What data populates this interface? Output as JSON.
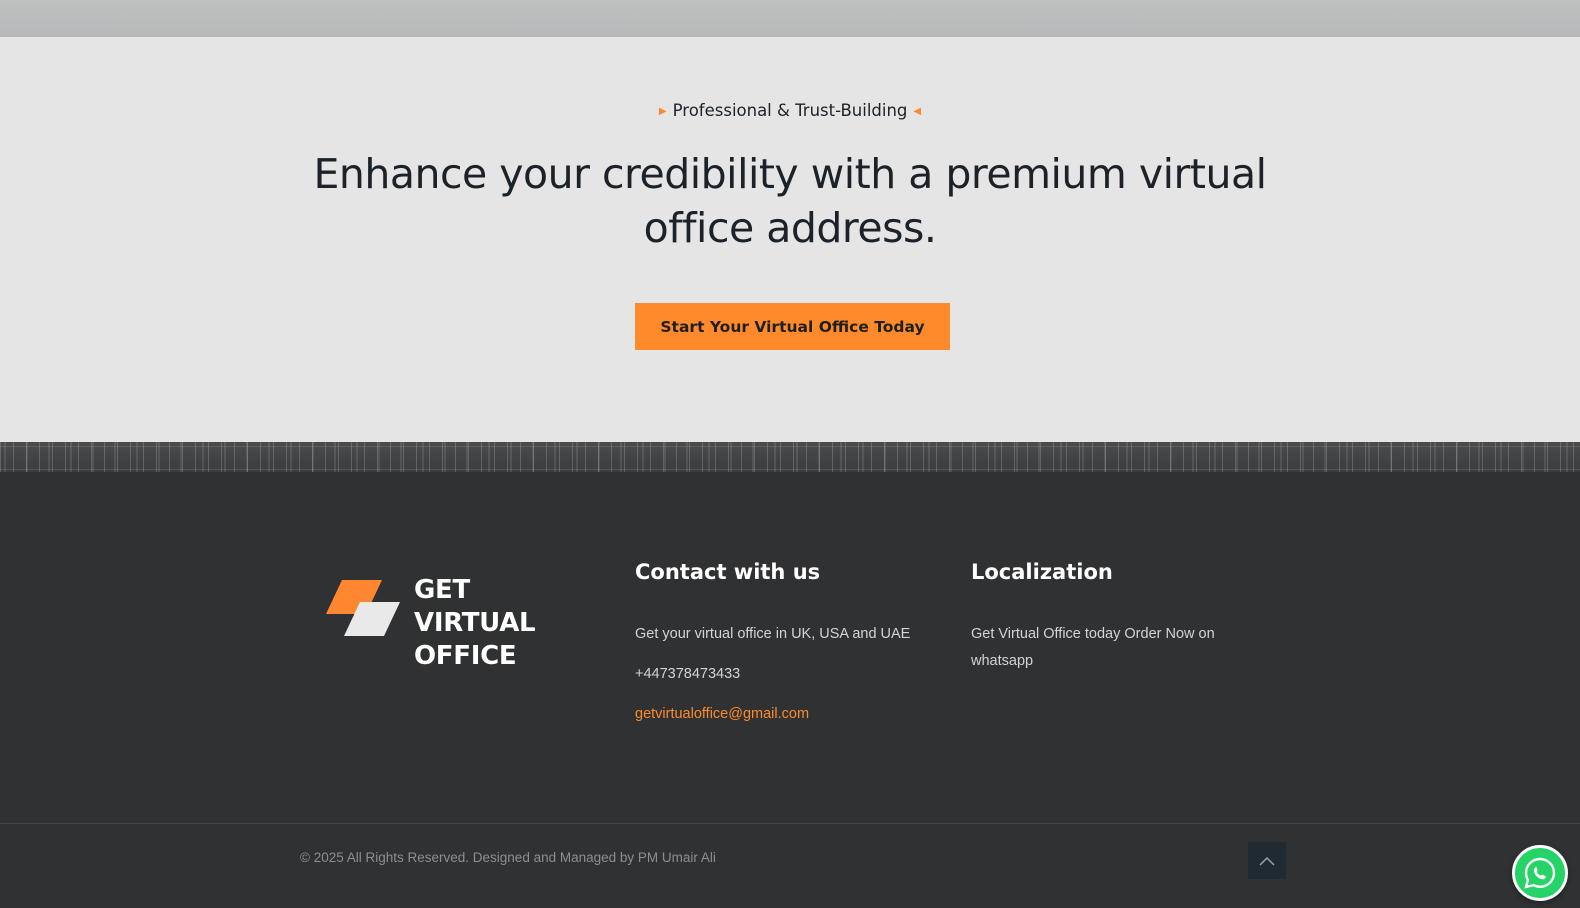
{
  "cta": {
    "eyebrow": "Professional & Trust-Building",
    "heading": "Enhance your credibility with a premium virtual office address.",
    "button_label": "Start Your Virtual Office Today"
  },
  "footer": {
    "logo": {
      "line1": "GET VIRTUAL",
      "line2": "OFFICE"
    },
    "contact": {
      "title": "Contact with us",
      "description": "Get your virtual office in UK, USA and UAE",
      "phone": "+447378473433",
      "email": "getvirtualoffice@gmail.com"
    },
    "localization": {
      "title": "Localization",
      "line1": "Get Virtual Office today Order Now on",
      "line2": "whatsapp"
    },
    "copyright": "© 2025 All Rights Reserved. Designed and Managed by PM Umair Ali"
  },
  "colors": {
    "accent": "#ff8a2c",
    "footer_bg": "#2f3132",
    "cta_bg": "#e5e5e5",
    "whatsapp": "#25d366"
  },
  "icons": {
    "logo_mark": "parallelogram-logo-icon",
    "back_to_top": "chevron-up-icon",
    "whatsapp": "whatsapp-icon"
  }
}
